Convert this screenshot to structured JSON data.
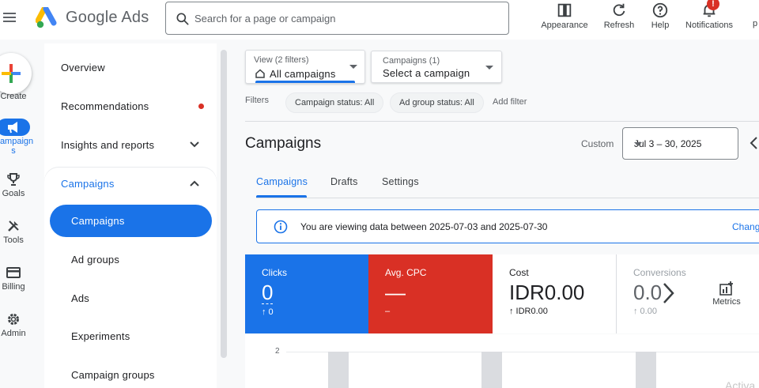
{
  "app": {
    "brand": "Google Ads",
    "colors": {
      "accent": "#1a73e8",
      "danger": "#d93025",
      "text": "#202124"
    }
  },
  "topbar": {
    "search_placeholder": "Search for a page or campaign",
    "actions": [
      {
        "label": "Appearance",
        "icon": "appearance-icon"
      },
      {
        "label": "Refresh",
        "icon": "refresh-icon"
      },
      {
        "label": "Help",
        "icon": "help-icon"
      },
      {
        "label": "Notifications",
        "icon": "bell-icon",
        "badge": "!"
      }
    ],
    "cut_label": "p"
  },
  "rail": {
    "create_label": "Create",
    "items": [
      {
        "label": "Campaign\ns",
        "icon": "megaphone-icon",
        "active": true
      },
      {
        "label": "Goals",
        "icon": "trophy-icon"
      },
      {
        "label": "Tools",
        "icon": "tools-icon"
      },
      {
        "label": "Billing",
        "icon": "credit-card-icon"
      },
      {
        "label": "Admin",
        "icon": "gear-icon"
      }
    ]
  },
  "nav": {
    "top_items": [
      {
        "label": "Overview"
      },
      {
        "label": "Recommendations"
      },
      {
        "label": "Insights and reports"
      }
    ],
    "section": {
      "label": "Campaigns",
      "items": [
        {
          "label": "Campaigns"
        },
        {
          "label": "Ad groups"
        },
        {
          "label": "Ads"
        },
        {
          "label": "Experiments"
        },
        {
          "label": "Campaign groups"
        }
      ]
    }
  },
  "view_selector": {
    "small": "View (2 filters)",
    "value": "All campaigns"
  },
  "campaign_selector": {
    "small": "Campaigns (1)",
    "value": "Select a campaign"
  },
  "filters": {
    "label": "Filters",
    "chips": [
      "Campaign status: All",
      "Ad group status: All"
    ],
    "add": "Add filter"
  },
  "page": {
    "title": "Campaigns",
    "date_label": "Custom",
    "date_range": "Jul 3 – 30, 2025",
    "tabs": [
      "Campaigns",
      "Drafts",
      "Settings"
    ]
  },
  "info": {
    "message": "You are viewing data between 2025-07-03 and 2025-07-30",
    "action": "Chang"
  },
  "metrics": [
    {
      "name": "Clicks",
      "value": "0",
      "delta": "↑ 0"
    },
    {
      "name": "Avg. CPC",
      "value": "—",
      "delta": "–"
    },
    {
      "name": "Cost",
      "value": "IDR0.00",
      "delta": "↑ IDR0.00"
    },
    {
      "name": "Conversions",
      "value": "0.0",
      "delta": "↑ 0.00"
    }
  ],
  "metrics_button": "Metrics",
  "chart": {
    "tick_label": "2"
  },
  "watermark": "Activa"
}
